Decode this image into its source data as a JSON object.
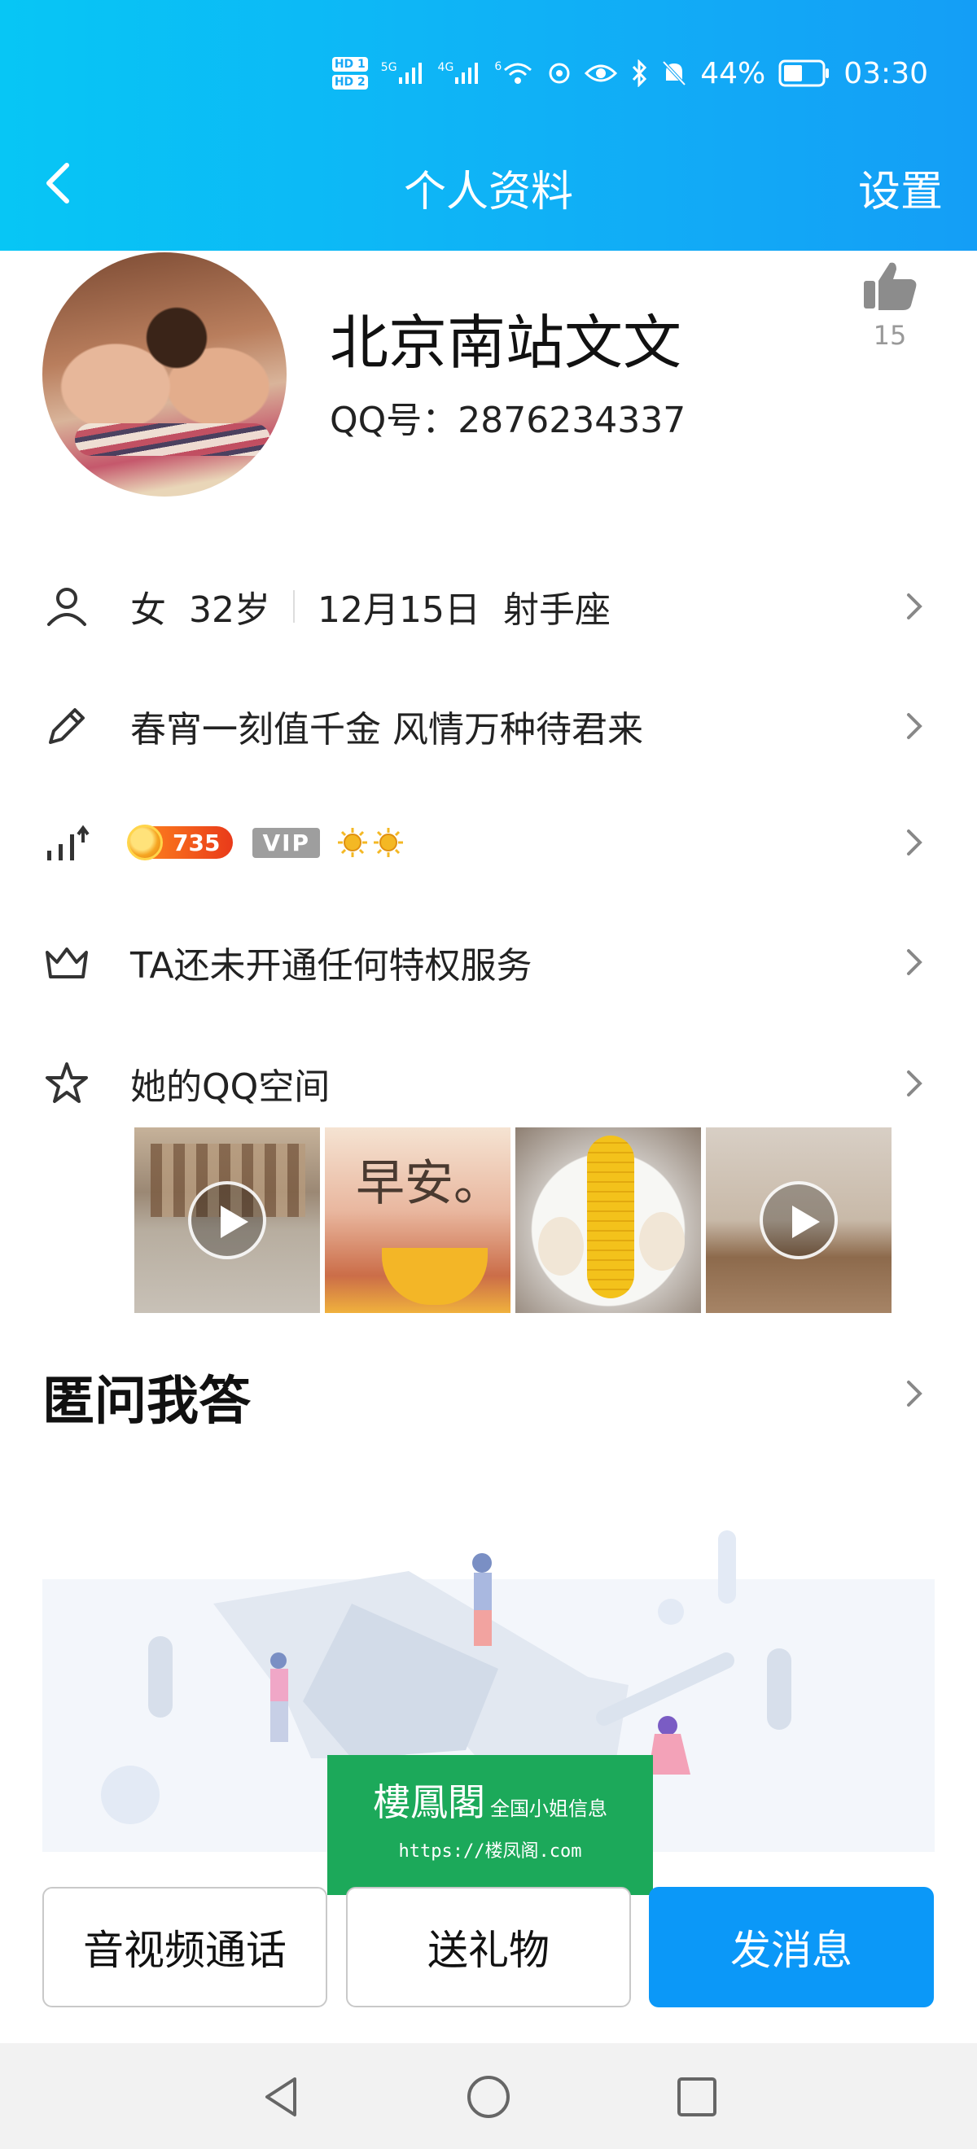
{
  "status_bar": {
    "hd1": "HD 1",
    "hd2": "HD 2",
    "network1": "5G",
    "network2": "4G",
    "wifi": "6",
    "battery": "44%",
    "time": "03:30"
  },
  "nav": {
    "title": "个人资料",
    "settings": "设置"
  },
  "profile": {
    "nickname": "北京南站文文",
    "qq_line": "QQ号：2876234337",
    "likes": "15"
  },
  "rows": {
    "gender": "女",
    "age": "32岁",
    "birthday": "12月15日",
    "zodiac": "射手座",
    "signature": "春宵一刻值千金  风情万种待君来",
    "level_coins": "735",
    "level_vip": "VIP",
    "privilege": "TA还未开通任何特权服务",
    "qzone": "她的QQ空间"
  },
  "photos": {
    "p2_text": "早安。"
  },
  "qa": {
    "title": "匿问我答"
  },
  "watermark": {
    "brand": "樓鳳閣",
    "tagline": "全国小姐信息",
    "url": "https://楼凤阁.com"
  },
  "buttons": {
    "call": "音视频通话",
    "gift": "送礼物",
    "message": "发消息"
  },
  "colors": {
    "header_start": "#07c6f5",
    "header_end": "#149ef6",
    "primary_button": "#0b98f8",
    "watermark_bg": "#1ca95a"
  }
}
